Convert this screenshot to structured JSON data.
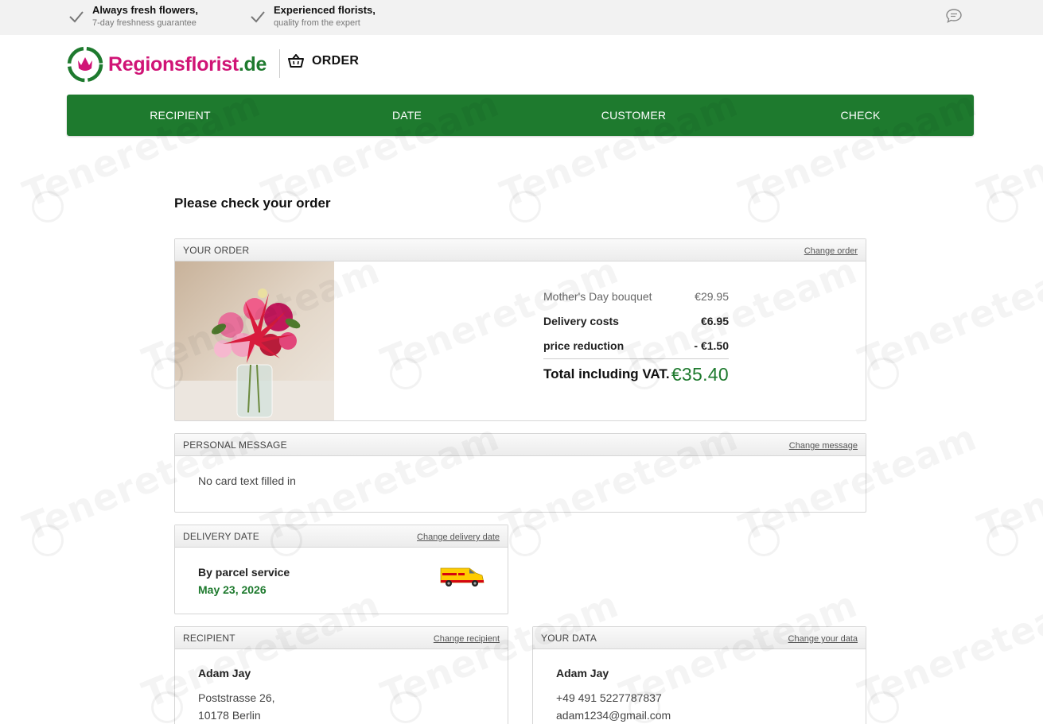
{
  "usp": [
    {
      "title": "Always fresh flowers,",
      "sub": "7-day freshness guarantee"
    },
    {
      "title": "Experienced florists,",
      "sub": "quality from the expert"
    }
  ],
  "icons": {
    "check": "check-icon",
    "chat": "chat-bubble-icon",
    "basket": "basket-icon",
    "logo": "tulip-logo-icon",
    "van": "dhl-van-icon"
  },
  "brand": {
    "name": "Regionsflorist",
    "tld": ".de",
    "primary_color": "#d01476",
    "green": "#1e7a2e"
  },
  "header": {
    "order_label": "ORDER"
  },
  "steps": [
    "RECIPIENT",
    "DATE",
    "CUSTOMER",
    "CHECK"
  ],
  "page_title": "Please check your order",
  "order": {
    "title": "YOUR ORDER",
    "change": "Change order",
    "lines": [
      {
        "label": "Mother's Day bouquet",
        "amount": "€29.95"
      },
      {
        "label": "Delivery costs",
        "amount": "€6.95"
      },
      {
        "label": "price reduction",
        "amount": "- €1.50"
      }
    ],
    "total_label": "Total including VAT.",
    "total_amount": "€35.40"
  },
  "message": {
    "title": "PERSONAL MESSAGE",
    "change": "Change message",
    "text": "No card text filled in"
  },
  "delivery": {
    "title": "DELIVERY DATE",
    "change": "Change delivery date",
    "method": "By parcel service",
    "date": "May 23, 2026"
  },
  "recipient": {
    "title": "RECIPIENT",
    "change": "Change recipient",
    "name": "Adam Jay",
    "street": "Poststrasse 26,",
    "city": "10178 Berlin"
  },
  "your_data": {
    "title": "YOUR DATA",
    "change": "Change your data",
    "name": "Adam Jay",
    "phone": "+49 491 5227787837",
    "email": "adam1234@gmail.com"
  },
  "watermark": "Tenereteam"
}
